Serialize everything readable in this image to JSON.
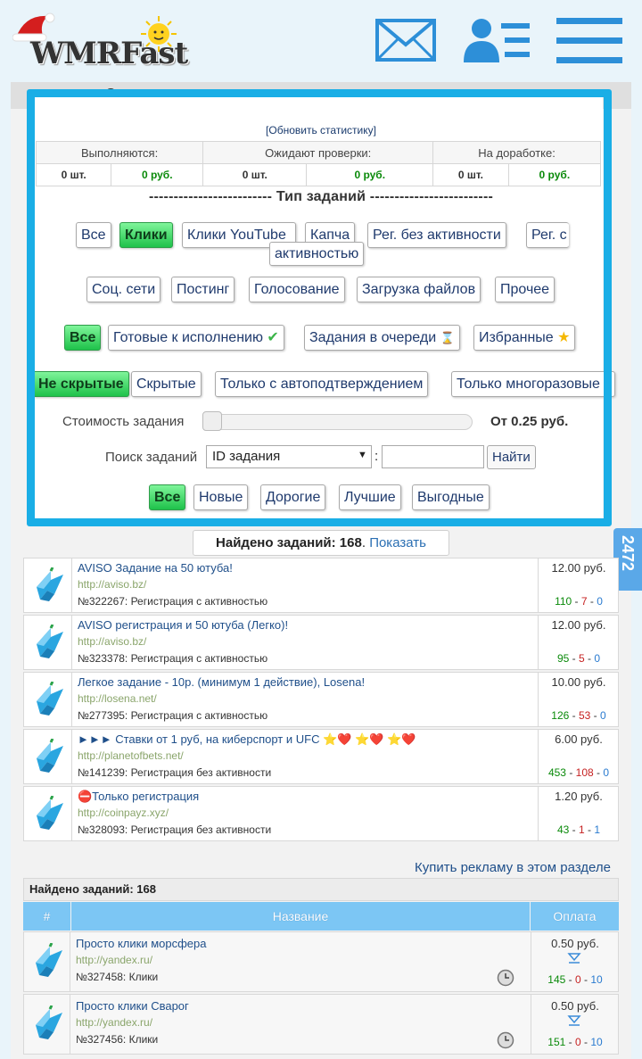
{
  "header": {
    "logo_text": "WMRFast",
    "icons": [
      "mail-icon",
      "profile-list-icon",
      "menu-icon"
    ]
  },
  "panel_title": "Оплачиваемые задания",
  "refresh_label": "[Обновить статистику]",
  "stats": {
    "headers": [
      "Выполняются:",
      "Ожидают проверки:",
      "На доработке:"
    ],
    "values": [
      "0 шт.",
      "0 руб.",
      "0 шт.",
      "0 руб.",
      "0 шт.",
      "0 руб."
    ]
  },
  "section_title": "------------------------- Тип заданий -------------------------",
  "type_buttons": [
    "Все",
    "Клики",
    "Клики YouTube",
    "Капча",
    "Рег. без активности",
    "Рег. с",
    "активностью"
  ],
  "category_buttons": [
    "Соц. сети",
    "Постинг",
    "Голосование",
    "Загрузка файлов",
    "Прочее"
  ],
  "status_buttons": [
    "Все",
    "Готовые к исполнению",
    "Задания в очереди",
    "Избранные"
  ],
  "visibility_buttons": [
    "Не скрытые",
    "Скрытые",
    "Только с автоподтверждением",
    "Только многоразовые"
  ],
  "cost": {
    "label": "Стоимость задания",
    "value": "От 0.25 руб."
  },
  "search": {
    "label": "Поиск заданий",
    "select": "ID задания",
    "colon": ":",
    "button": "Найти"
  },
  "sort_buttons": [
    "Все",
    "Новые",
    "Дорогие",
    "Лучшие",
    "Выгодные"
  ],
  "found": {
    "prefix": "Найдено заданий: 168",
    "suffix": ". ",
    "link": "Показать"
  },
  "side_tab": "2472",
  "premium_tasks": [
    {
      "title": "AVISO Задание на 50 ютуба!",
      "url": "http://aviso.bz/",
      "num": "№322267: Регистрация с активностью",
      "price": "12.00 руб.",
      "a": "110",
      "b": "7",
      "c": "0"
    },
    {
      "title": "AVISO регистрация и 50 ютуба (Легко)!",
      "url": "http://aviso.bz/",
      "num": "№323378: Регистрация с активностью",
      "price": "12.00 руб.",
      "a": "95",
      "b": "5",
      "c": "0"
    },
    {
      "title": "Легкое задание - 10р. (минимум 1 действие), Losena!",
      "url": "http://losena.net/",
      "num": "№277395: Регистрация с активностью",
      "price": "10.00 руб.",
      "a": "126",
      "b": "53",
      "c": "0"
    },
    {
      "title": "►►► Ставки от 1 руб, на киберспорт и UFC ⭐❤️ ⭐❤️ ⭐❤️",
      "url": "http://planetofbets.net/",
      "num": "№141239: Регистрация без активности",
      "price": "6.00 руб.",
      "a": "453",
      "b": "108",
      "c": "0"
    },
    {
      "title": "⛔Только регистрация",
      "url": "http://coinpayz.xyz/",
      "num": "№328093: Регистрация без активности",
      "price": "1.20 руб.",
      "a": "43",
      "b": "1",
      "c": "1"
    }
  ],
  "buy_ad": "Купить рекламу в этом разделе",
  "found2": "Найдено заданий: 168",
  "table_headers": [
    "#",
    "Название",
    "Оплата"
  ],
  "click_tasks": [
    {
      "title": "Просто клики морсфера",
      "url": "http://yandex.ru/",
      "num": "№327458: Клики",
      "price": "0.50 руб.",
      "a": "145",
      "b": "0",
      "c": "10"
    },
    {
      "title": "Просто клики Сварог",
      "url": "http://yandex.ru/",
      "num": "№327456: Клики",
      "price": "0.50 руб.",
      "a": "151",
      "b": "0",
      "c": "10"
    }
  ],
  "colors": {
    "accent_frame": "#1aaee6",
    "green_button": "#1ec24a",
    "table_header": "#7cc6f4"
  }
}
